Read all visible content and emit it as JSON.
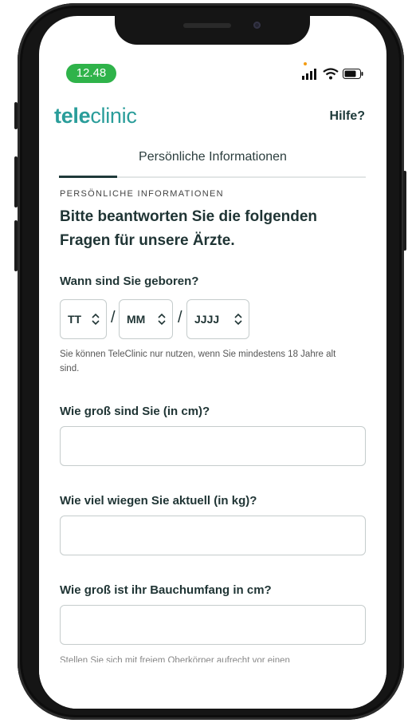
{
  "status_bar": {
    "time": "12.48"
  },
  "header": {
    "logo_bold": "tele",
    "logo_regular": "clinic",
    "help_link": "Hilfe?"
  },
  "tabs": {
    "active_label": "Persönliche Informationen"
  },
  "form": {
    "section_eyebrow": "PERSÖNLICHE INFORMATIONEN",
    "heading": "Bitte beantworten Sie die folgenden Fragen für unsere Ärzte.",
    "birth_question": "Wann sind Sie geboren?",
    "day_placeholder": "TT",
    "month_placeholder": "MM",
    "year_placeholder": "JJJJ",
    "separator": "/",
    "age_hint": "Sie können TeleClinic nur nutzen, wenn Sie mindestens 18 Jahre alt sind.",
    "height_question": "Wie groß sind Sie (in cm)?",
    "weight_question": "Wie viel wiegen Sie aktuell (in kg)?",
    "waist_question": "Wie groß ist ihr Bauchumfang in cm?",
    "waist_hint_partial": "Stellen Sie sich mit freiem Oberkörper aufrecht vor einen"
  },
  "colors": {
    "brand_teal": "#2a9d9a",
    "text_dark": "#1f3434",
    "time_pill": "#2fb34a"
  }
}
